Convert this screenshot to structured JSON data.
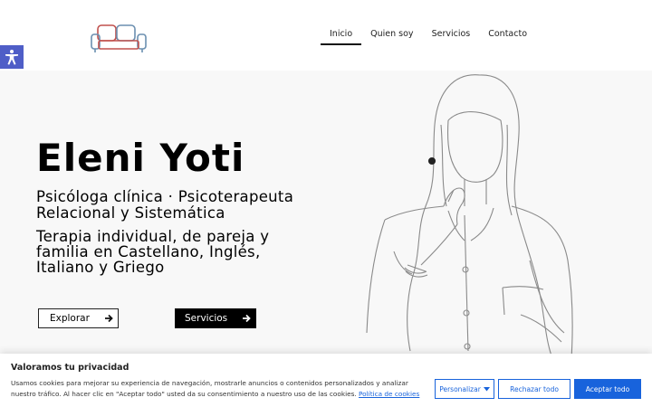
{
  "header": {
    "logo_icon": "sofa-icon",
    "nav": [
      {
        "label": "Inicio",
        "active": true
      },
      {
        "label": "Quien soy",
        "active": false
      },
      {
        "label": "Servicios",
        "active": false
      },
      {
        "label": "Contacto",
        "active": false
      }
    ]
  },
  "accessibility": {
    "icon": "accessibility-icon",
    "color": "#4f5ec7"
  },
  "hero": {
    "title": "Eleni Yoti",
    "subtitle_1": "Psicóloga clínica · Psicoterapeuta Relacional y Sistemática",
    "subtitle_2": "Terapia individual, de pareja y familia en Castellano, Inglés, Italiano y Griego",
    "explore_label": "Explorar",
    "services_label": "Servicios",
    "arrow_icon": "arrow-right-icon"
  },
  "cookies": {
    "title": "Valoramos tu privacidad",
    "text": "Usamos cookies para mejorar su experiencia de navegación, mostrarle anuncios o contenidos personalizados y analizar nuestro tráfico. Al hacer clic en \"Aceptar todo\" usted da su consentimiento a nuestro uso de las cookies.",
    "policy_link": "Política de cookies",
    "customize_label": "Personalizar",
    "reject_label": "Rechazar todo",
    "accept_label": "Aceptar todo",
    "accent_color": "#1863dc"
  }
}
